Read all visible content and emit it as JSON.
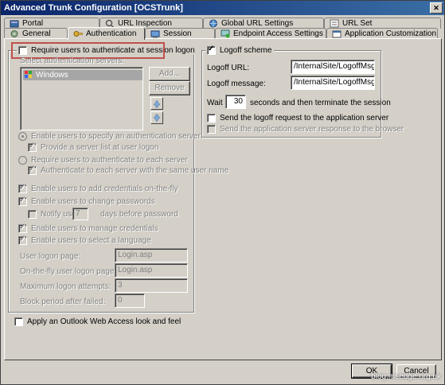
{
  "window": {
    "title": "Advanced Trunk Configuration [OCSTrunk]"
  },
  "tabs_row1": [
    {
      "label": "Portal",
      "icon": "portal-icon"
    },
    {
      "label": "URL Inspection",
      "icon": "url-inspection-icon"
    },
    {
      "label": "Global URL Settings",
      "icon": "global-url-icon"
    },
    {
      "label": "URL Set",
      "icon": "url-set-icon"
    }
  ],
  "tabs_row2": [
    {
      "label": "General",
      "icon": "general-icon"
    },
    {
      "label": "Authentication",
      "icon": "authentication-icon",
      "active": true
    },
    {
      "label": "Session",
      "icon": "session-icon"
    },
    {
      "label": "Endpoint Access Settings",
      "icon": "endpoint-icon"
    },
    {
      "label": "Application Customization",
      "icon": "app-customization-icon"
    }
  ],
  "auth": {
    "require_label": "Require users to authenticate at session logon",
    "require_checked": false,
    "select_servers_label": "Select authentication servers:",
    "servers": [
      "Windows"
    ],
    "add_button": "Add...",
    "remove_button": "Remove",
    "specify_server_label": "Enable users to specify an authentication server",
    "provide_list_label": "Provide a server list at user logon",
    "each_server_label": "Require users to authenticate to each server",
    "same_name_label": "Authenticate to each server with the same user name",
    "add_credentials_label": "Enable users to add credentials on-the-fly",
    "change_passwords_label": "Enable users to change passwords",
    "notify_user_label": "Notify user",
    "notify_days": "7",
    "days_before_label": "days before password",
    "manage_credentials_label": "Enable users to manage credentials",
    "select_language_label": "Enable users to select a language",
    "logon_page_label": "User logon page:",
    "logon_page_value": "Login.asp",
    "onthefly_label": "On-the-fly user logon page:",
    "onthefly_value": "Login.asp",
    "max_attempts_label": "Maximum logon attempts:",
    "max_attempts_value": "3",
    "block_period_label": "Block period after failed:",
    "block_period_value": "0"
  },
  "logoff": {
    "scheme_label": "Logoff scheme",
    "scheme_checked": true,
    "url_label": "Logoff URL:",
    "url_value": "/InternalSite/LogoffMsg.asp",
    "message_label": "Logoff message:",
    "message_value": "/InternalSite/LogoffMsg.asp",
    "wait_label": "Wait",
    "wait_value": "30",
    "wait_suffix": "seconds and then terminate the session",
    "send_request_label": "Send the logoff request to the application server",
    "send_response_label": "Send the application server response to the browser"
  },
  "owa_label": "Apply an Outlook Web Access look and feel",
  "buttons": {
    "ok": "OK",
    "cancel": "Cancel"
  },
  "watermark": "blog.msedge.org.uk",
  "colors": {
    "title_start": "#0a246a",
    "title_end": "#3a6ea5",
    "highlight": "#c0504d"
  }
}
